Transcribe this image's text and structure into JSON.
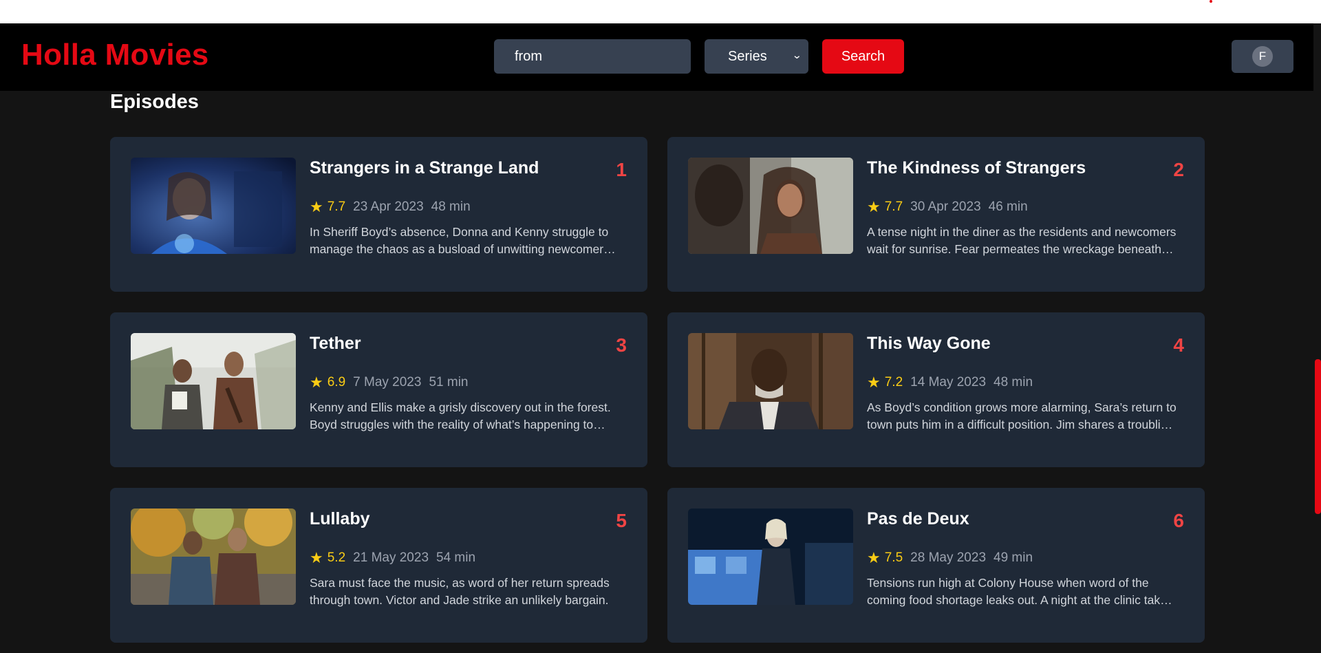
{
  "header": {
    "logo": "Holla Movies",
    "search": {
      "value": "from"
    },
    "type_select": {
      "value": "Series"
    },
    "search_label": "Search",
    "profile_initial": "F"
  },
  "section_title": "Episodes",
  "episodes": [
    {
      "number": "1",
      "title": "Strangers in a Strange Land",
      "rating": "7.7",
      "date": "23 Apr 2023",
      "runtime": "48 min",
      "description": "In Sheriff Boyd’s absence, Donna and Kenny struggle to manage the chaos as a busload of unwitting newcomers arrives in town."
    },
    {
      "number": "2",
      "title": "The Kindness of Strangers",
      "rating": "7.7",
      "date": "30 Apr 2023",
      "runtime": "46 min",
      "description": "A tense night in the diner as the residents and newcomers wait for sunrise. Fear permeates the wreckage beneath the surface."
    },
    {
      "number": "3",
      "title": "Tether",
      "rating": "6.9",
      "date": "7 May 2023",
      "runtime": "51 min",
      "description": "Kenny and Ellis make a grisly discovery out in the forest. Boyd struggles with the reality of what’s happening to him."
    },
    {
      "number": "4",
      "title": "This Way Gone",
      "rating": "7.2",
      "date": "14 May 2023",
      "runtime": "48 min",
      "description": "As Boyd’s condition grows more alarming, Sara’s return to town puts him in a difficult position. Jim shares a troubling theory."
    },
    {
      "number": "5",
      "title": "Lullaby",
      "rating": "5.2",
      "date": "21 May 2023",
      "runtime": "54 min",
      "description": "Sara must face the music, as word of her return spreads through town. Victor and Jade strike an unlikely bargain."
    },
    {
      "number": "6",
      "title": "Pas de Deux",
      "rating": "7.5",
      "date": "28 May 2023",
      "runtime": "49 min",
      "description": "Tensions run high at Colony House when word of the coming food shortage leaks out. A night at the clinic takes a turn."
    }
  ]
}
